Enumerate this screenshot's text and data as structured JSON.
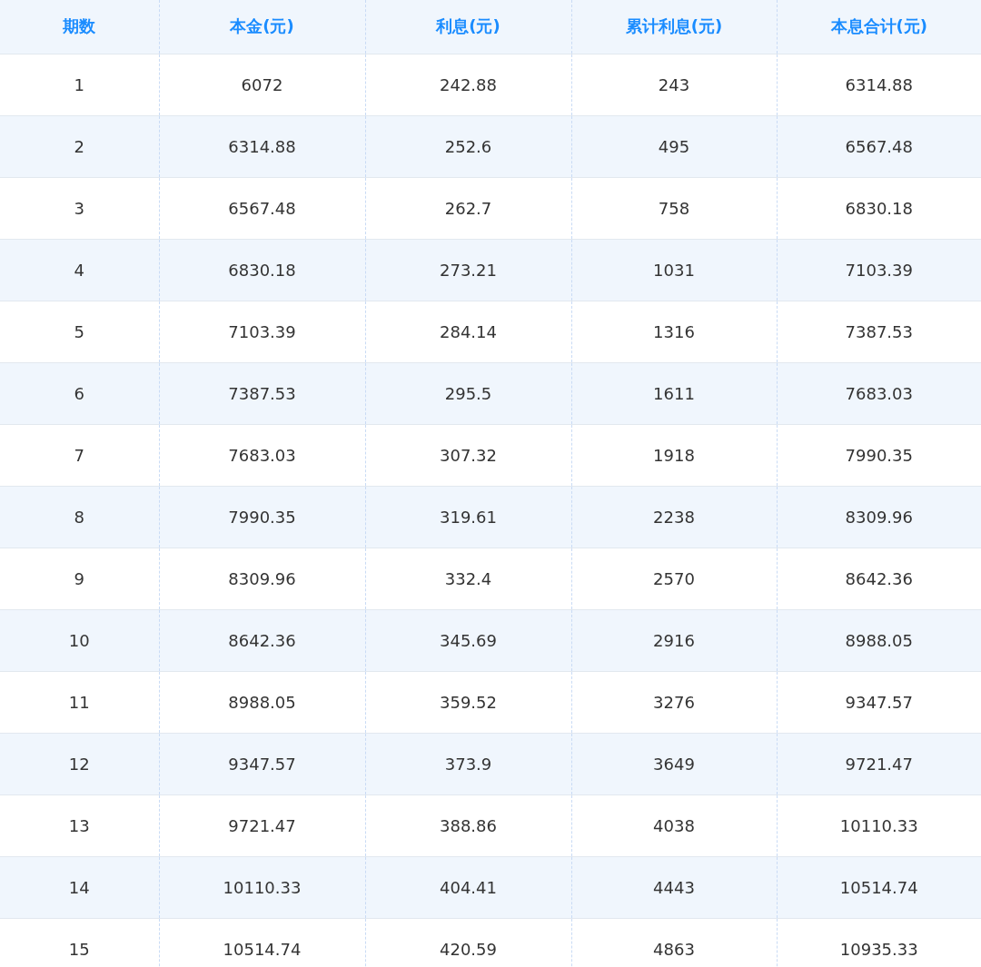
{
  "table": {
    "columns": [
      "期数",
      "本金(元)",
      "利息(元)",
      "累计利息(元)",
      "本息合计(元)"
    ],
    "rows": [
      [
        "1",
        "6072",
        "242.88",
        "243",
        "6314.88"
      ],
      [
        "2",
        "6314.88",
        "252.6",
        "495",
        "6567.48"
      ],
      [
        "3",
        "6567.48",
        "262.7",
        "758",
        "6830.18"
      ],
      [
        "4",
        "6830.18",
        "273.21",
        "1031",
        "7103.39"
      ],
      [
        "5",
        "7103.39",
        "284.14",
        "1316",
        "7387.53"
      ],
      [
        "6",
        "7387.53",
        "295.5",
        "1611",
        "7683.03"
      ],
      [
        "7",
        "7683.03",
        "307.32",
        "1918",
        "7990.35"
      ],
      [
        "8",
        "7990.35",
        "319.61",
        "2238",
        "8309.96"
      ],
      [
        "9",
        "8309.96",
        "332.4",
        "2570",
        "8642.36"
      ],
      [
        "10",
        "8642.36",
        "345.69",
        "2916",
        "8988.05"
      ],
      [
        "11",
        "8988.05",
        "359.52",
        "3276",
        "9347.57"
      ],
      [
        "12",
        "9347.57",
        "373.9",
        "3649",
        "9721.47"
      ],
      [
        "13",
        "9721.47",
        "388.86",
        "4038",
        "10110.33"
      ],
      [
        "14",
        "10110.33",
        "404.41",
        "4443",
        "10514.74"
      ],
      [
        "15",
        "10514.74",
        "420.59",
        "4863",
        "10935.33"
      ]
    ]
  }
}
